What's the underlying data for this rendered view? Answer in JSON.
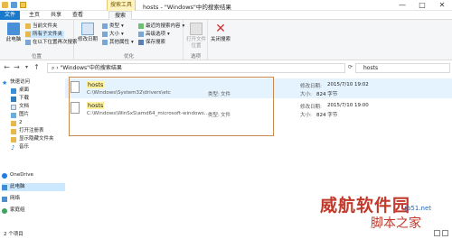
{
  "title_bar": {
    "contextual_tab": "搜索工具",
    "title": "hosts - \"Windows\"中的搜索结果",
    "controls": [
      "—",
      "□",
      "✕"
    ]
  },
  "tabs": {
    "file": "文件",
    "home": "主页",
    "share": "共享",
    "view": "查看",
    "search": "搜索"
  },
  "ribbon": {
    "location": {
      "this_pc": "此电脑",
      "current_folder": "当前文件夹",
      "all_subfolders": "所有子文件夹",
      "search_again_in": "在以下位置再次搜索",
      "group_label": "位置"
    },
    "refine": {
      "date_modified": "修改日期",
      "kind": "类型",
      "size": "大小",
      "other_properties": "其他属性",
      "group_label": "优化"
    },
    "options": {
      "recent_searches": "最近的搜索内容",
      "advanced_options": "高级选项",
      "save_search": "保存搜索",
      "open_file_location": "打开文件位置",
      "group_label": "选项"
    },
    "close": {
      "close_search": "关闭搜索"
    }
  },
  "address_bar": {
    "path": "\"Windows\"中的搜索结果",
    "search_query": "hosts"
  },
  "nav_pane": {
    "items": [
      {
        "label": "快速访问",
        "icon": "star-icon"
      },
      {
        "label": "桌面",
        "icon": "desktop-icon"
      },
      {
        "label": "下载",
        "icon": "download-icon"
      },
      {
        "label": "文档",
        "icon": "document-icon"
      },
      {
        "label": "图片",
        "icon": "picture-icon"
      },
      {
        "label": "2",
        "icon": "folder-icon"
      },
      {
        "label": "打开注册表",
        "icon": "folder-icon"
      },
      {
        "label": "显示隐藏文件夹",
        "icon": "folder-icon"
      },
      {
        "label": "音乐",
        "icon": "music-icon"
      },
      {
        "label": "OneDrive",
        "icon": "cloud-icon"
      },
      {
        "label": "此电脑",
        "icon": "computer-icon"
      },
      {
        "label": "网络",
        "icon": "network-icon"
      },
      {
        "label": "家庭组",
        "icon": "homegroup-icon"
      }
    ]
  },
  "results": [
    {
      "name": "hosts",
      "path": "C:\\Windows\\System32\\drivers\\etc",
      "type_label": "类型:",
      "type_value": "文件",
      "modified_label": "修改日期:",
      "modified_value": "2015/7/10 19:02",
      "size_label": "大小:",
      "size_value": "824 字节"
    },
    {
      "name": "hosts",
      "path": "C:\\Windows\\WinSxS\\amd64_microsoft-windows...",
      "type_label": "类型:",
      "type_value": "文件",
      "modified_label": "修改日期:",
      "modified_value": "2015/7/10 19:00",
      "size_label": "大小:",
      "size_value": "824 字节"
    }
  ],
  "status_bar": {
    "item_count": "2 个项目"
  },
  "watermark": {
    "main": "威航软件园",
    "sub": "脚本之家",
    "url": "jb51.net"
  },
  "colors": {
    "file_tab": "#1979ca",
    "selection": "#cce8ff",
    "highlight": "#fff29e",
    "annotation_box": "#c98a4f",
    "watermark": "#c0392b"
  }
}
